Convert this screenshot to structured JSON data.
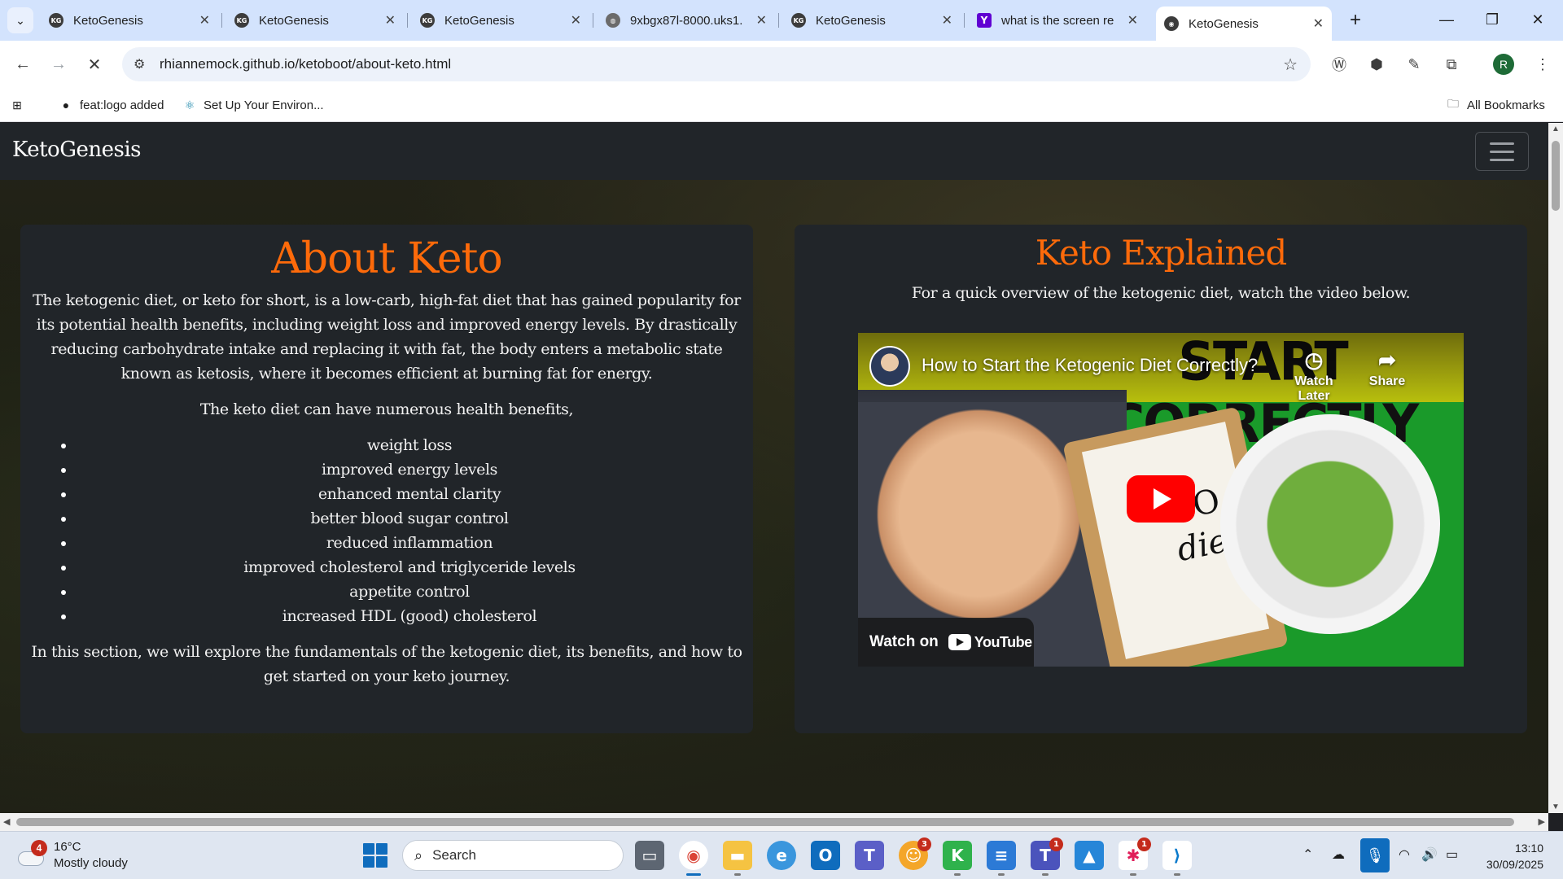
{
  "browser": {
    "tabs": [
      {
        "title": "KetoGenesis",
        "favicon": "KG",
        "active": false
      },
      {
        "title": "KetoGenesis",
        "favicon": "KG",
        "active": false
      },
      {
        "title": "KetoGenesis",
        "favicon": "KG",
        "active": false
      },
      {
        "title": "9xbgx87l-8000.uks1.",
        "favicon": "globe",
        "active": false
      },
      {
        "title": "KetoGenesis",
        "favicon": "KG",
        "active": false
      },
      {
        "title": "what is the screen re",
        "favicon": "Y",
        "active": false
      },
      {
        "title": "KetoGenesis",
        "favicon": "KG",
        "active": true
      }
    ],
    "url": "rhiannemock.github.io/ketoboot/about-keto.html",
    "profile_initial": "R",
    "bookmarks": [
      {
        "label": "feat:logo added",
        "icon": "github-icon"
      },
      {
        "label": "Set Up Your Environ...",
        "icon": "react-icon"
      }
    ],
    "all_bookmarks_label": "All Bookmarks"
  },
  "site": {
    "brand": "KetoGenesis",
    "about": {
      "heading": "About Keto",
      "intro": "The ketogenic diet, or keto for short, is a low-carb, high-fat diet that has gained popularity for its potential health benefits, including weight loss and improved energy levels. By drastically reducing carbohydrate intake and replacing it with fat, the body enters a metabolic state known as ketosis, where it becomes efficient at burning fat for energy.",
      "benefits_lead": "The keto diet can have numerous health benefits,",
      "benefits": [
        "weight loss",
        "improved energy levels",
        "enhanced mental clarity",
        "better blood sugar control",
        "reduced inflammation",
        "improved cholesterol and triglyceride levels",
        "appetite control",
        "increased HDL (good) cholesterol"
      ],
      "outro": "In this section, we will explore the fundamentals of the ketogenic diet, its benefits, and how to get started on your keto journey."
    },
    "explained": {
      "heading": "Keto Explained",
      "subtitle": "For a quick overview of the ketogenic diet, watch the video below.",
      "video": {
        "title": "How to Start the Ketogenic Diet Correctly?",
        "thumbnail_text": "START CORRECTLY",
        "clipboard_text_top": "O",
        "clipboard_text": "diet",
        "watch_later": "Watch Later",
        "share": "Share",
        "watch_on": "Watch on",
        "youtube": "YouTube"
      }
    }
  },
  "taskbar": {
    "weather_temp": "16°C",
    "weather_desc": "Mostly cloudy",
    "weather_badge": "4",
    "search_placeholder": "Search",
    "time": "13:10",
    "date": "30/09/2025",
    "badges": {
      "discord": "3",
      "teams": "1",
      "slack": "1"
    }
  },
  "colors": {
    "accent_orange": "#fd6a0a",
    "card_bg": "#212529",
    "navbar_bg": "#212529"
  }
}
